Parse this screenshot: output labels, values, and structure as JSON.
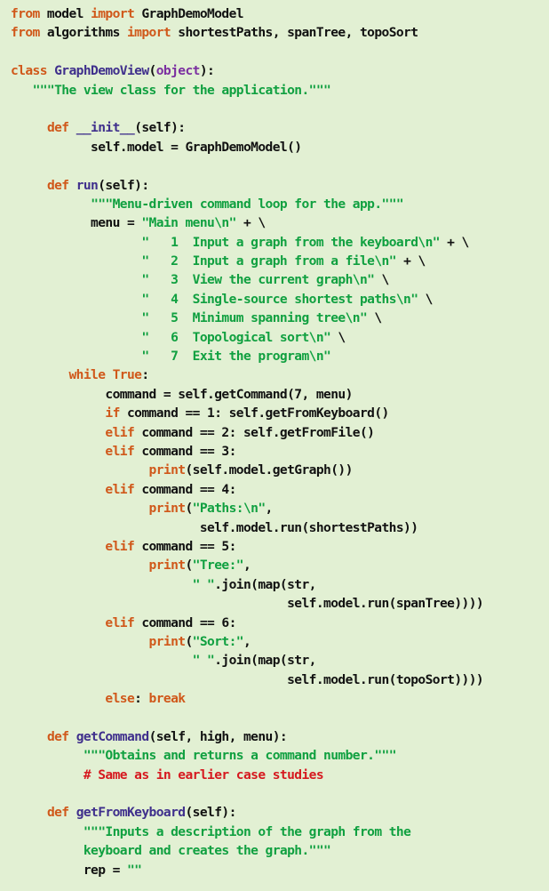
{
  "colors": {
    "background": "#e2f0d3",
    "keyword": "#d0581a",
    "class_name": "#7b2fa0",
    "function_name": "#3f2f8c",
    "string": "#10a040",
    "comment": "#d6191f",
    "plain": "#111111"
  },
  "code": [
    [
      [
        "kw",
        "from"
      ],
      [
        "pl",
        " model "
      ],
      [
        "kw",
        "import"
      ],
      [
        "pl",
        " GraphDemoModel"
      ]
    ],
    [
      [
        "kw",
        "from"
      ],
      [
        "pl",
        " algorithms "
      ],
      [
        "kw",
        "import"
      ],
      [
        "pl",
        " shortestPaths, spanTree, topoSort"
      ]
    ],
    [],
    [
      [
        "kw",
        "class"
      ],
      [
        "pl",
        " "
      ],
      [
        "fn",
        "GraphDemoView"
      ],
      [
        "pl",
        "("
      ],
      [
        "cls",
        "object"
      ],
      [
        "pl",
        "):"
      ]
    ],
    [
      [
        "pl",
        "   "
      ],
      [
        "str",
        "\"\"\"The view class for the application.\"\"\""
      ]
    ],
    [],
    [
      [
        "pl",
        "     "
      ],
      [
        "kw",
        "def"
      ],
      [
        "pl",
        " "
      ],
      [
        "fn",
        "__init__"
      ],
      [
        "pl",
        "(self):"
      ]
    ],
    [
      [
        "pl",
        "           self.model = GraphDemoModel()"
      ]
    ],
    [],
    [
      [
        "pl",
        "     "
      ],
      [
        "kw",
        "def"
      ],
      [
        "pl",
        " "
      ],
      [
        "fn",
        "run"
      ],
      [
        "pl",
        "(self):"
      ]
    ],
    [
      [
        "pl",
        "           "
      ],
      [
        "str",
        "\"\"\"Menu-driven command loop for the app.\"\"\""
      ]
    ],
    [
      [
        "pl",
        "           menu = "
      ],
      [
        "str",
        "\"Main menu\\n\""
      ],
      [
        "pl",
        " + \\"
      ]
    ],
    [
      [
        "pl",
        "                  "
      ],
      [
        "str",
        "\"   1  Input a graph from the keyboard\\n\""
      ],
      [
        "pl",
        " + \\"
      ]
    ],
    [
      [
        "pl",
        "                  "
      ],
      [
        "str",
        "\"   2  Input a graph from a file\\n\""
      ],
      [
        "pl",
        " + \\"
      ]
    ],
    [
      [
        "pl",
        "                  "
      ],
      [
        "str",
        "\"   3  View the current graph\\n\""
      ],
      [
        "pl",
        " \\"
      ]
    ],
    [
      [
        "pl",
        "                  "
      ],
      [
        "str",
        "\"   4  Single-source shortest paths\\n\""
      ],
      [
        "pl",
        " \\"
      ]
    ],
    [
      [
        "pl",
        "                  "
      ],
      [
        "str",
        "\"   5  Minimum spanning tree\\n\""
      ],
      [
        "pl",
        " \\"
      ]
    ],
    [
      [
        "pl",
        "                  "
      ],
      [
        "str",
        "\"   6  Topological sort\\n\""
      ],
      [
        "pl",
        " \\"
      ]
    ],
    [
      [
        "pl",
        "                  "
      ],
      [
        "str",
        "\"   7  Exit the program\\n\""
      ]
    ],
    [
      [
        "pl",
        "        "
      ],
      [
        "kw",
        "while"
      ],
      [
        "pl",
        " "
      ],
      [
        "kw",
        "True"
      ],
      [
        "pl",
        ":"
      ]
    ],
    [
      [
        "pl",
        "             command = self.getCommand(7, menu)"
      ]
    ],
    [
      [
        "pl",
        "             "
      ],
      [
        "kw",
        "if"
      ],
      [
        "pl",
        " command == 1: self.getFromKeyboard()"
      ]
    ],
    [
      [
        "pl",
        "             "
      ],
      [
        "kw",
        "elif"
      ],
      [
        "pl",
        " command == 2: self.getFromFile()"
      ]
    ],
    [
      [
        "pl",
        "             "
      ],
      [
        "kw",
        "elif"
      ],
      [
        "pl",
        " command == 3:"
      ]
    ],
    [
      [
        "pl",
        "                   "
      ],
      [
        "kw",
        "print"
      ],
      [
        "pl",
        "(self.model.getGraph())"
      ]
    ],
    [
      [
        "pl",
        "             "
      ],
      [
        "kw",
        "elif"
      ],
      [
        "pl",
        " command == 4:"
      ]
    ],
    [
      [
        "pl",
        "                   "
      ],
      [
        "kw",
        "print"
      ],
      [
        "pl",
        "("
      ],
      [
        "str",
        "\"Paths:\\n\""
      ],
      [
        "pl",
        ","
      ]
    ],
    [
      [
        "pl",
        "                          self.model.run(shortestPaths))"
      ]
    ],
    [
      [
        "pl",
        "             "
      ],
      [
        "kw",
        "elif"
      ],
      [
        "pl",
        " command == 5:"
      ]
    ],
    [
      [
        "pl",
        "                   "
      ],
      [
        "kw",
        "print"
      ],
      [
        "pl",
        "("
      ],
      [
        "str",
        "\"Tree:\""
      ],
      [
        "pl",
        ","
      ]
    ],
    [
      [
        "pl",
        "                         "
      ],
      [
        "str",
        "\" \""
      ],
      [
        "pl",
        ".join(map(str,"
      ]
    ],
    [
      [
        "pl",
        "                                      self.model.run(spanTree))))"
      ]
    ],
    [
      [
        "pl",
        "             "
      ],
      [
        "kw",
        "elif"
      ],
      [
        "pl",
        " command == 6:"
      ]
    ],
    [
      [
        "pl",
        "                   "
      ],
      [
        "kw",
        "print"
      ],
      [
        "pl",
        "("
      ],
      [
        "str",
        "\"Sort:\""
      ],
      [
        "pl",
        ","
      ]
    ],
    [
      [
        "pl",
        "                         "
      ],
      [
        "str",
        "\" \""
      ],
      [
        "pl",
        ".join(map(str,"
      ]
    ],
    [
      [
        "pl",
        "                                      self.model.run(topoSort))))"
      ]
    ],
    [
      [
        "pl",
        "             "
      ],
      [
        "kw",
        "else"
      ],
      [
        "pl",
        ": "
      ],
      [
        "kw",
        "break"
      ]
    ],
    [],
    [
      [
        "pl",
        "     "
      ],
      [
        "kw",
        "def"
      ],
      [
        "pl",
        " "
      ],
      [
        "fn",
        "getCommand"
      ],
      [
        "pl",
        "(self, high, menu):"
      ]
    ],
    [
      [
        "pl",
        "          "
      ],
      [
        "str",
        "\"\"\"Obtains and returns a command number.\"\"\""
      ]
    ],
    [
      [
        "pl",
        "          "
      ],
      [
        "cm",
        "# Same as in earlier case studies"
      ]
    ],
    [],
    [
      [
        "pl",
        "     "
      ],
      [
        "kw",
        "def"
      ],
      [
        "pl",
        " "
      ],
      [
        "fn",
        "getFromKeyboard"
      ],
      [
        "pl",
        "(self):"
      ]
    ],
    [
      [
        "pl",
        "          "
      ],
      [
        "str",
        "\"\"\"Inputs a description of the graph from the"
      ]
    ],
    [
      [
        "pl",
        "          "
      ],
      [
        "str",
        "keyboard and creates the graph.\"\"\""
      ]
    ],
    [
      [
        "pl",
        "          rep = "
      ],
      [
        "str",
        "\"\""
      ]
    ]
  ]
}
